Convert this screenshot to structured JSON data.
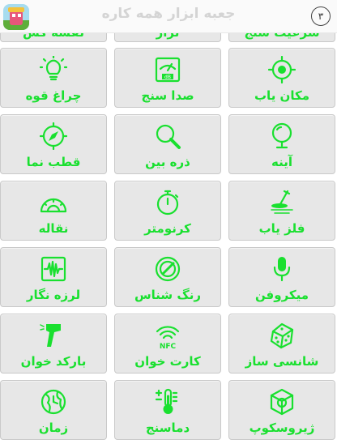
{
  "header": {
    "title": "جعبه ابزار همه کاره",
    "back_badge": "۳"
  },
  "accent_color": "#19e02f",
  "rows": [
    [
      "نقشه کش",
      "تراز",
      "شرعیت سنج"
    ],
    [
      "چراغ قوه",
      "صدا سنج",
      "مکان یاب"
    ],
    [
      "قطب نما",
      "ذره بین",
      "آینه"
    ],
    [
      "نقاله",
      "کرنومتر",
      "فلز یاب"
    ],
    [
      "لرزه نگار",
      "رنگ شناس",
      "میکروفن"
    ],
    [
      "بارکد خوان",
      "کارت خوان",
      "شانسی ساز"
    ],
    [
      "زمان",
      "دماسنج",
      "ژیروسکوپ"
    ]
  ],
  "icons": {
    "r1c1": "bulb-icon",
    "r1c2": "decibel-meter-icon",
    "r1c3": "location-target-icon",
    "r2c1": "compass-icon",
    "r2c2": "magnifier-icon",
    "r2c3": "mirror-icon",
    "r3c1": "protractor-icon",
    "r3c2": "stopwatch-icon",
    "r3c3": "metal-detector-icon",
    "r4c1": "seismograph-icon",
    "r4c2": "color-picker-icon",
    "r4c3": "microphone-icon",
    "r5c1": "barcode-scanner-icon",
    "r5c2": "nfc-icon",
    "r5c3": "dice-icon",
    "r6c1": "globe-clock-icon",
    "r6c2": "thermometer-icon",
    "r6c3": "gyroscope-icon"
  },
  "nfc_text": "NFC",
  "db_text": "dB"
}
